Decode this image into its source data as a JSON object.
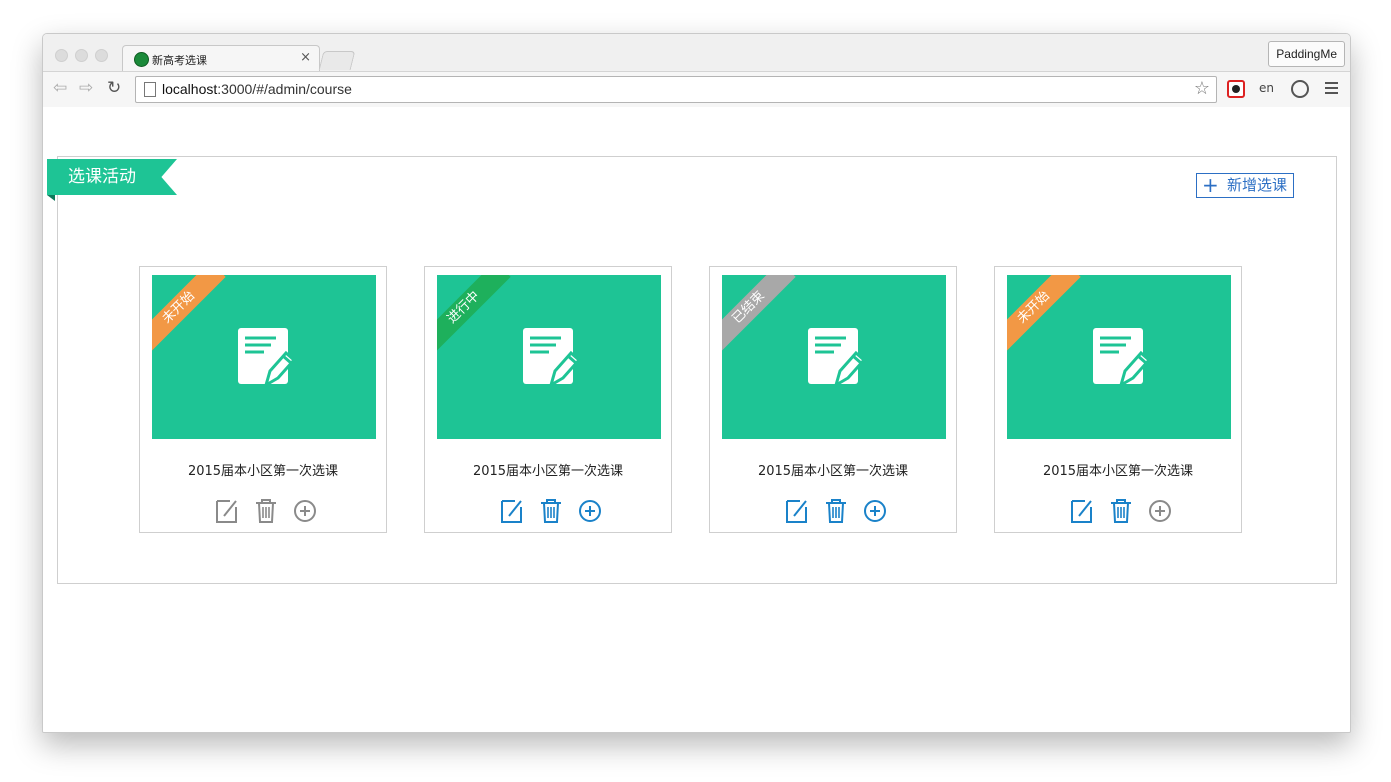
{
  "browser": {
    "tab_title": "新高考选课",
    "tab_close": "×",
    "extension_button": "PaddingMe",
    "url_host": "localhost",
    "url_rest": ":3000/#/admin/course",
    "translate_label": "en"
  },
  "page": {
    "section_title": "选课活动",
    "add_button_label": "新增选课",
    "add_button_icon": "+",
    "colors": {
      "accent": "#1ec495",
      "link": "#2c6fc4",
      "status_not_started": "#f29845",
      "status_in_progress": "#1eb05c",
      "status_finished": "#a8a8a8",
      "action_active": "#1a82c9",
      "action_disabled": "#8a8a8a"
    }
  },
  "cards": [
    {
      "status": "未开始",
      "status_color": "#f29845",
      "title": "2015届本小区第一次选课",
      "actions_active": [
        false,
        false,
        false
      ]
    },
    {
      "status": "进行中",
      "status_color": "#1eb05c",
      "title": "2015届本小区第一次选课",
      "actions_active": [
        true,
        true,
        true
      ]
    },
    {
      "status": "已结束",
      "status_color": "#a8a8a8",
      "title": "2015届本小区第一次选课",
      "actions_active": [
        true,
        true,
        true
      ]
    },
    {
      "status": "未开始",
      "status_color": "#f29845",
      "title": "2015届本小区第一次选课",
      "actions_active": [
        true,
        true,
        false
      ]
    }
  ]
}
